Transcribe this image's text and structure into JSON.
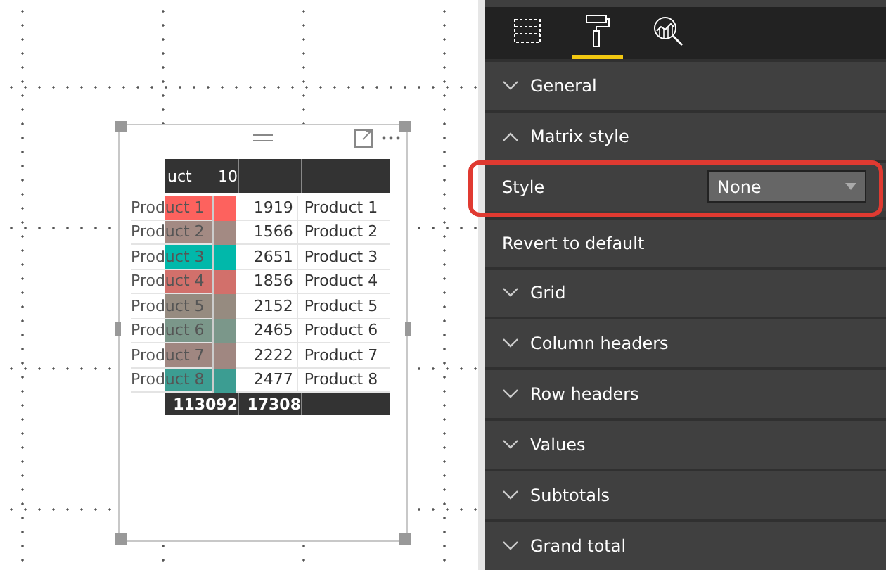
{
  "canvas": {
    "visual": {
      "header_cells": [
        "uct",
        "10",
        "",
        ""
      ],
      "rows": [
        {
          "label": "Product 1",
          "color": "#fd625e",
          "value": "1919",
          "product": "Product 1"
        },
        {
          "label": "Product 2",
          "color": "#a38a83",
          "value": "1566",
          "product": "Product 2"
        },
        {
          "label": "Product 3",
          "color": "#01b8aa",
          "value": "2651",
          "product": "Product 3"
        },
        {
          "label": "Product 4",
          "color": "#d2706b",
          "value": "1856",
          "product": "Product 4"
        },
        {
          "label": "Product 5",
          "color": "#968b80",
          "value": "2152",
          "product": "Product 5"
        },
        {
          "label": "Product 6",
          "color": "#7b978a",
          "value": "2465",
          "product": "Product 6"
        },
        {
          "label": "Product 7",
          "color": "#a08781",
          "value": "2222",
          "product": "Product 7"
        },
        {
          "label": "Product 8",
          "color": "#3c9d92",
          "value": "2477",
          "product": "Product 8"
        }
      ],
      "totals": [
        "113092",
        "17308"
      ]
    }
  },
  "panel": {
    "tabs": [
      {
        "kind": "fields",
        "selected": false
      },
      {
        "kind": "format",
        "selected": true
      },
      {
        "kind": "analytics",
        "selected": false
      }
    ],
    "items": [
      {
        "kind": "section",
        "label": "General",
        "expanded": false
      },
      {
        "kind": "section",
        "label": "Matrix style",
        "expanded": true
      },
      {
        "kind": "dropdown",
        "label": "Style",
        "value": "None",
        "highlighted": true
      },
      {
        "kind": "action",
        "label": "Revert to default"
      },
      {
        "kind": "section",
        "label": "Grid",
        "expanded": false
      },
      {
        "kind": "section",
        "label": "Column headers",
        "expanded": false
      },
      {
        "kind": "section",
        "label": "Row headers",
        "expanded": false
      },
      {
        "kind": "section",
        "label": "Values",
        "expanded": false
      },
      {
        "kind": "section",
        "label": "Subtotals",
        "expanded": false
      },
      {
        "kind": "section",
        "label": "Grand total",
        "expanded": false
      }
    ]
  }
}
